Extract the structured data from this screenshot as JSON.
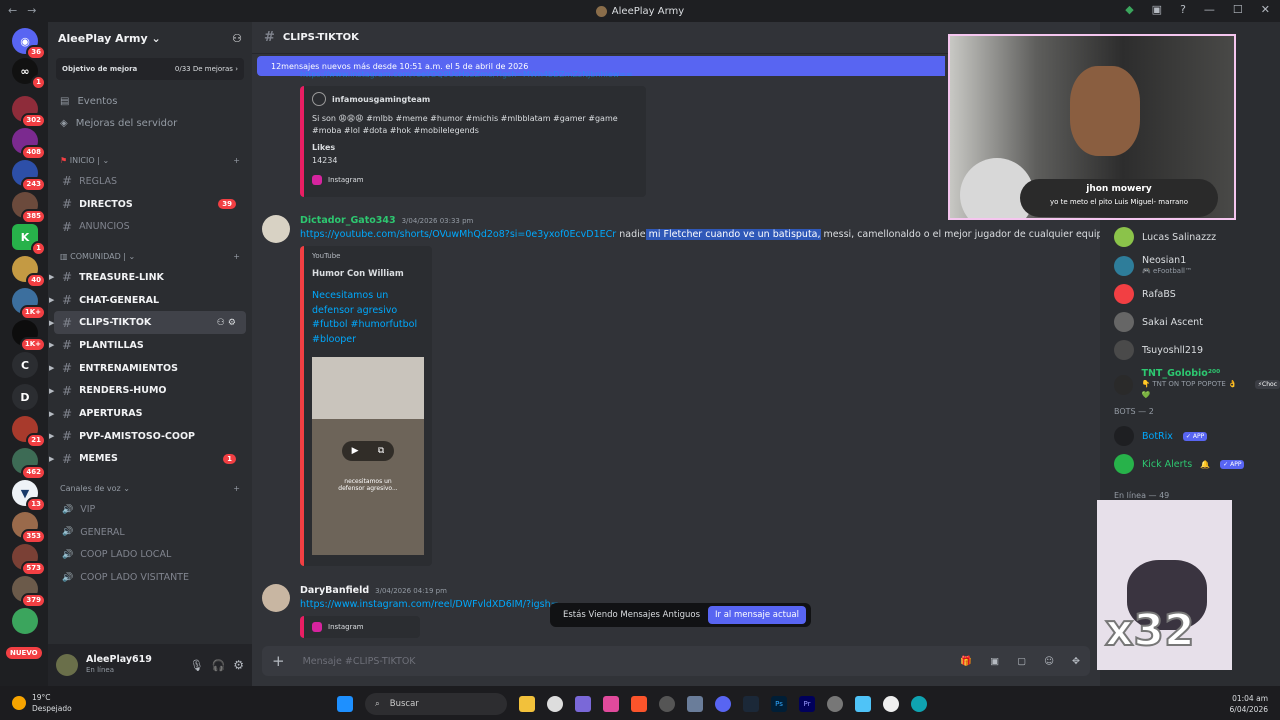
{
  "window": {
    "title": "AleePlay Army"
  },
  "servers": {
    "badges": [
      "36",
      "1",
      "302",
      "408",
      "243",
      "385",
      "1",
      "40",
      "1K+",
      "1K+",
      "21",
      "462",
      "13",
      "353",
      "573",
      "379"
    ],
    "letters": [
      "C",
      "D"
    ],
    "nuevo": "NUEVO"
  },
  "guild": {
    "name": "AleePlay Army",
    "boost_label": "Objetivo de mejora",
    "boost_value": "0/33 De mejoras",
    "events": "Eventos",
    "server_boosts": "Mejoras del servidor",
    "cat_inicio": "INICIO",
    "cat_comunidad": "COMUNIDAD",
    "cat_voice": "Canales de voz",
    "inicio_channels": [
      {
        "name": "REGLAS",
        "muted": true,
        "count": ""
      },
      {
        "name": "DIRECTOS",
        "muted": false,
        "count": "39"
      },
      {
        "name": "ANUNCIOS",
        "muted": true,
        "count": ""
      }
    ],
    "comunidad_channels": [
      {
        "name": "TREASURE-LINK",
        "count": ""
      },
      {
        "name": "CHAT-GENERAL",
        "count": ""
      },
      {
        "name": "CLIPS-TIKTOK",
        "count": ""
      },
      {
        "name": "PLANTILLAS",
        "count": ""
      },
      {
        "name": "ENTRENAMIENTOS",
        "count": ""
      },
      {
        "name": "RENDERS-HUMO",
        "count": ""
      },
      {
        "name": "APERTURAS",
        "count": ""
      },
      {
        "name": "PVP-AMISTOSO-COOP",
        "count": ""
      },
      {
        "name": "MEMES",
        "count": "1"
      }
    ],
    "voice_channels": [
      "VIP",
      "GENERAL",
      "COOP LADO LOCAL",
      "COOP LADO VISITANTE"
    ]
  },
  "user": {
    "name": "AleePlay619",
    "status": "En línea"
  },
  "channel": {
    "name": "CLIPS-TIKTOK"
  },
  "new_messages_bar": "12mensajes nuevos más desde 10:51 a.m. el 5 de abril de 2026",
  "embed1": {
    "top_link": "https://www.instagram.com/reel/DQ9UcHo2Zmo/?igsh=MWh4bDZmZzNjbnhiew==",
    "author": "infamousgamingteam",
    "text": "Si son 😩😩😩 #mlbb #meme #humor #michis #mlbblatam #gamer #game #moba #lol #dota #hok #mobilelegends",
    "likes_label": "Likes",
    "likes": "14234",
    "footer": "Instagram"
  },
  "message2": {
    "author": "Dictador_Gato343",
    "time": "3/04/2026 03:33 pm",
    "link": "https://youtube.com/shorts/OVuwMhQd2o8?si=0e3yxof0EcvD1ECr",
    "text_pre": " nadie",
    "text_sel": " mi Fletcher cuando ve un batisputa,",
    "text_post": " messi, camellonaldo o el mejor jugador de cualquier equipo",
    "provider": "YouTube",
    "channel": "Humor Con William",
    "title": "Necesitamos un defensor agresivo #futbol #humorfutbol #blooper",
    "caption": "necesitamos un defensor agresivo..."
  },
  "message3": {
    "author": "DaryBanfield",
    "time": "3/04/2026 04:19 pm",
    "link": "https://www.instagram.com/reel/DWFvldXD6IM/?igsh=",
    "footer": "Instagram"
  },
  "old_messages": {
    "text": "Estás Viendo Mensajes Antiguos",
    "button": "Ir al mensaje actual"
  },
  "composer": {
    "placeholder": "Mensaje #CLIPS-TIKTOK"
  },
  "webcam": {
    "name": "jhon mowery",
    "message": "yo te meto el pito Luis Miguel- marrano"
  },
  "members": {
    "online": [
      {
        "name": "Lucas Salinazzz",
        "sub": "",
        "color": "#dbdee1"
      },
      {
        "name": "Neosian1",
        "sub": "🎮 eFootball™",
        "color": "#dbdee1"
      },
      {
        "name": "RafaBS",
        "sub": "",
        "color": "#dbdee1"
      },
      {
        "name": "Sakai Ascent",
        "sub": "",
        "color": "#dbdee1"
      },
      {
        "name": "Tsuyoshll219",
        "sub": "",
        "color": "#dbdee1"
      },
      {
        "name": "TNT_Golobio²⁰⁰",
        "sub": "👇 TNT ON TOP POPOTE 👌 💚",
        "color": "#2dc770"
      }
    ],
    "bots_header": "BOTS — 2",
    "bots": [
      {
        "name": "BotRix",
        "tag": "✓ APP"
      },
      {
        "name": "Kick Alerts",
        "tag": "✓ APP"
      }
    ],
    "online_header": "En línea — 49",
    "tnt_badge": "⚡Choc"
  },
  "overlay": {
    "text": "x32"
  },
  "taskbar": {
    "temp": "19°C",
    "weather": "Despejado",
    "search": "Buscar",
    "time": "01:04 am",
    "date": "6/04/2026"
  }
}
